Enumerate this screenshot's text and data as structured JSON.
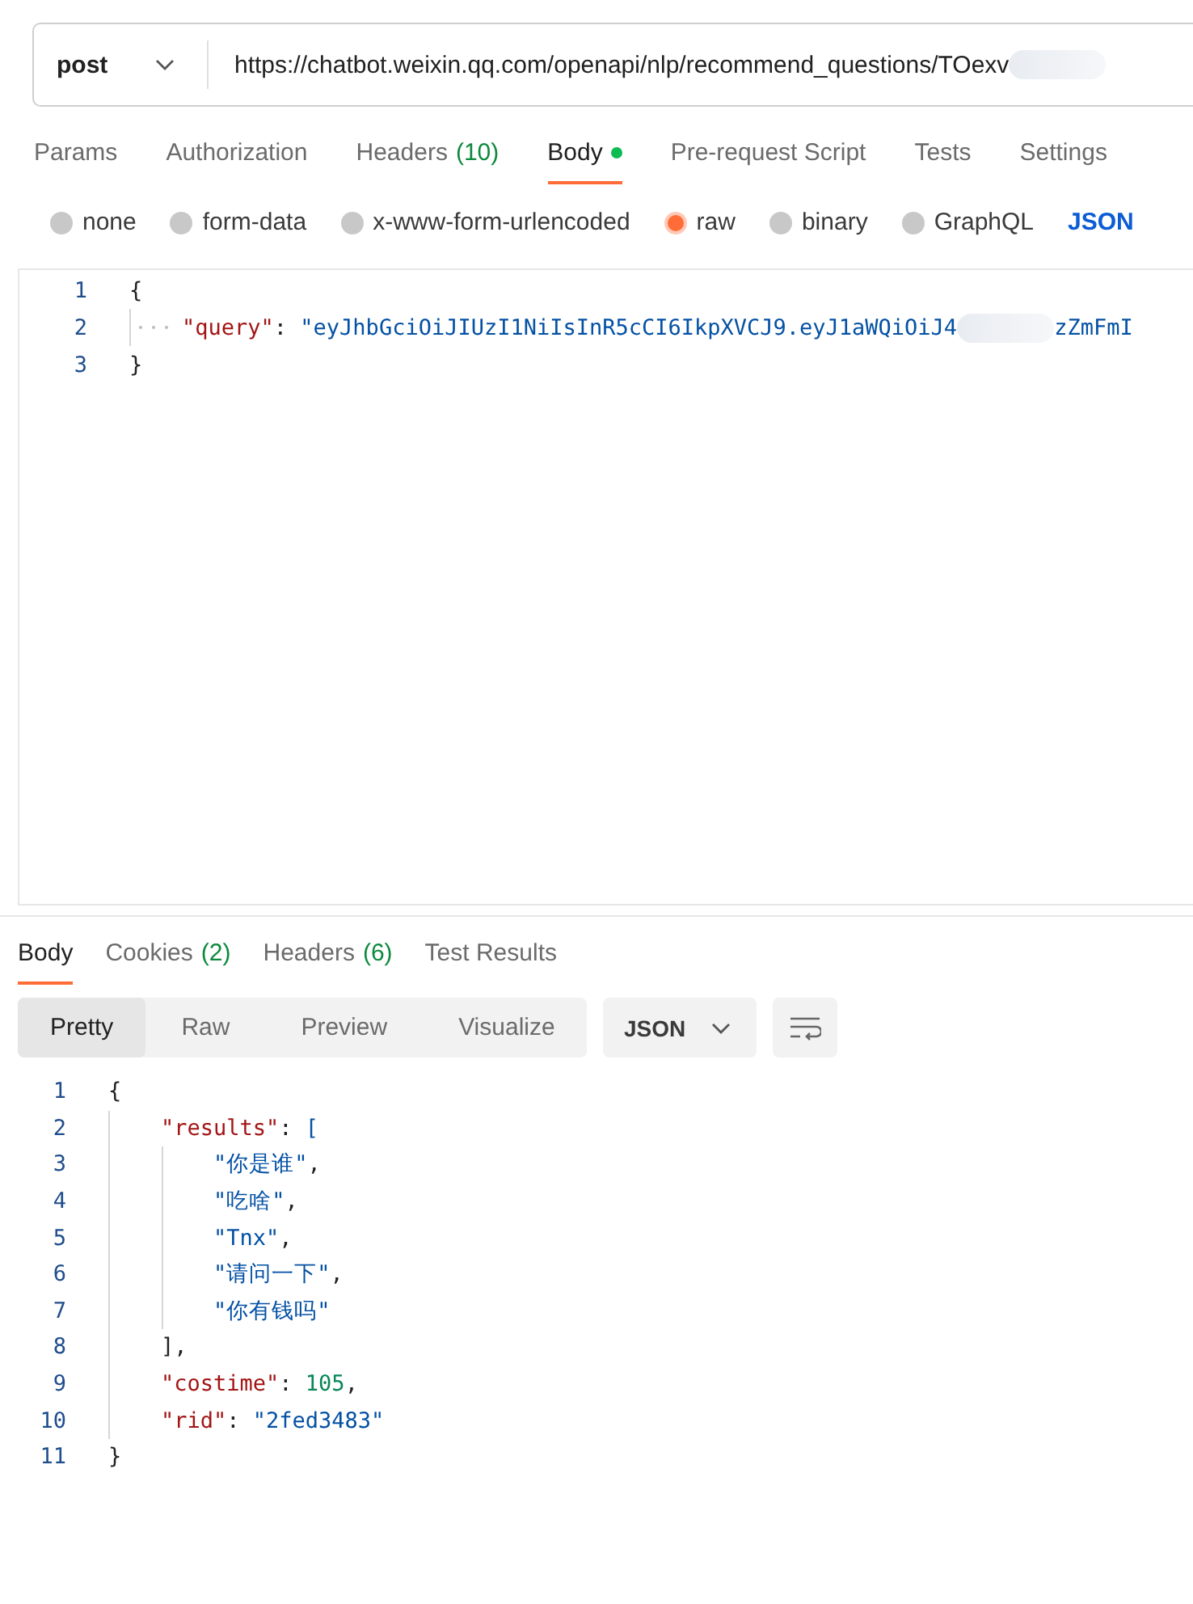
{
  "request": {
    "method": "post",
    "url": "https://chatbot.weixin.qq.com/openapi/nlp/recommend_questions/TOexv"
  },
  "request_tabs": [
    {
      "label": "Params",
      "selected": false
    },
    {
      "label": "Authorization",
      "selected": false
    },
    {
      "label": "Headers",
      "count": "(10)",
      "selected": false
    },
    {
      "label": "Body",
      "selected": true,
      "dot": true
    },
    {
      "label": "Pre-request Script",
      "selected": false
    },
    {
      "label": "Tests",
      "selected": false
    },
    {
      "label": "Settings",
      "selected": false
    }
  ],
  "body_types": [
    {
      "label": "none",
      "selected": false
    },
    {
      "label": "form-data",
      "selected": false
    },
    {
      "label": "x-www-form-urlencoded",
      "selected": false
    },
    {
      "label": "raw",
      "selected": true
    },
    {
      "label": "binary",
      "selected": false
    },
    {
      "label": "GraphQL",
      "selected": false
    }
  ],
  "body_format": "JSON",
  "request_body": {
    "show_whitespace": true,
    "lines": [
      {
        "number": "1",
        "tokens": [
          {
            "kind": "punct",
            "text": "{"
          }
        ],
        "children": [
          {
            "number": "2",
            "tokens": [
              {
                "kind": "key",
                "text": "\"query\""
              },
              {
                "kind": "punct",
                "text": ": "
              },
              {
                "kind": "string",
                "text": "\"eyJhbGciOiJIUzI1NiIsInR5cCI6IkpXVCJ9.eyJ1aWQiOiJ4"
              },
              {
                "kind": "redacted"
              },
              {
                "kind": "string",
                "text": "zZmFmI"
              }
            ]
          }
        ]
      },
      {
        "number": "3",
        "tokens": [
          {
            "kind": "punct",
            "text": "}"
          }
        ]
      }
    ]
  },
  "response_tabs": [
    {
      "label": "Body",
      "selected": true
    },
    {
      "label": "Cookies",
      "count": "(2)",
      "selected": false
    },
    {
      "label": "Headers",
      "count": "(6)",
      "selected": false
    },
    {
      "label": "Test Results",
      "selected": false
    }
  ],
  "view_modes": [
    {
      "label": "Pretty",
      "selected": true
    },
    {
      "label": "Raw",
      "selected": false
    },
    {
      "label": "Preview",
      "selected": false
    },
    {
      "label": "Visualize",
      "selected": false
    }
  ],
  "response_format": "JSON",
  "response_body": {
    "show_whitespace": false,
    "lines": [
      {
        "number": "1",
        "tokens": [
          {
            "kind": "punct",
            "text": "{"
          }
        ],
        "children": [
          {
            "number": "2",
            "tokens": [
              {
                "kind": "key",
                "text": "\"results\""
              },
              {
                "kind": "punct",
                "text": ": "
              },
              {
                "kind": "bracket",
                "text": "["
              }
            ],
            "children": [
              {
                "number": "3",
                "tokens": [
                  {
                    "kind": "string",
                    "text": "\"你是谁\""
                  },
                  {
                    "kind": "punct",
                    "text": ","
                  }
                ]
              },
              {
                "number": "4",
                "tokens": [
                  {
                    "kind": "string",
                    "text": "\"吃啥\""
                  },
                  {
                    "kind": "punct",
                    "text": ","
                  }
                ]
              },
              {
                "number": "5",
                "tokens": [
                  {
                    "kind": "string",
                    "text": "\"Tnx\""
                  },
                  {
                    "kind": "punct",
                    "text": ","
                  }
                ]
              },
              {
                "number": "6",
                "tokens": [
                  {
                    "kind": "string",
                    "text": "\"请问一下\""
                  },
                  {
                    "kind": "punct",
                    "text": ","
                  }
                ]
              },
              {
                "number": "7",
                "tokens": [
                  {
                    "kind": "string",
                    "text": "\"你有钱吗\""
                  }
                ]
              }
            ]
          },
          {
            "number": "8",
            "tokens": [
              {
                "kind": "punct",
                "text": "],"
              }
            ]
          },
          {
            "number": "9",
            "tokens": [
              {
                "kind": "key",
                "text": "\"costime\""
              },
              {
                "kind": "punct",
                "text": ": "
              },
              {
                "kind": "number",
                "text": "105"
              },
              {
                "kind": "punct",
                "text": ","
              }
            ]
          },
          {
            "number": "10",
            "tokens": [
              {
                "kind": "key",
                "text": "\"rid\""
              },
              {
                "kind": "punct",
                "text": ": "
              },
              {
                "kind": "string",
                "text": "\"2fed3483\""
              }
            ]
          }
        ]
      },
      {
        "number": "11",
        "tokens": [
          {
            "kind": "punct",
            "text": "}"
          }
        ]
      }
    ]
  }
}
